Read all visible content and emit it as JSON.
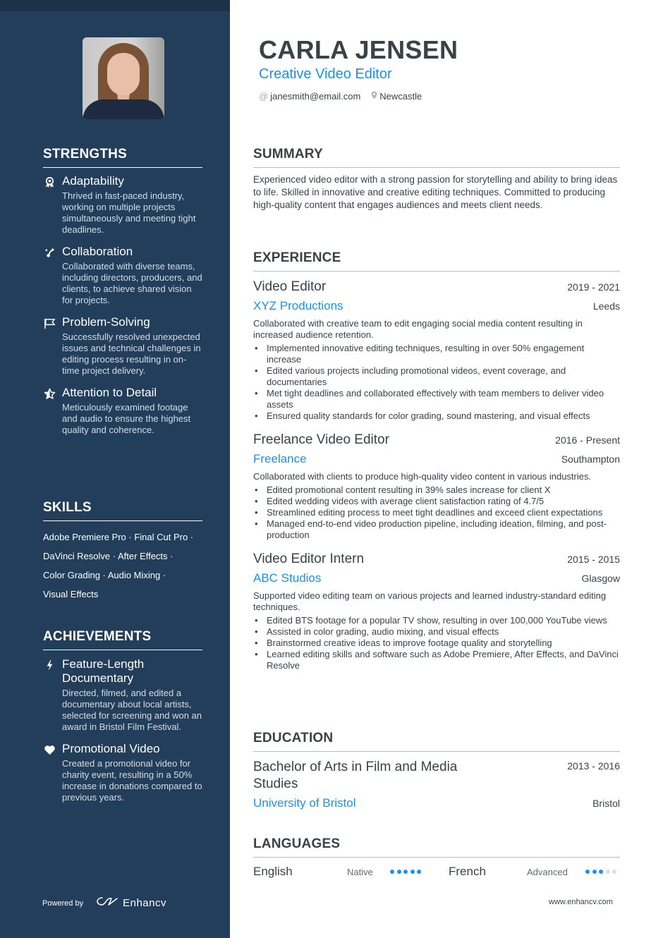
{
  "header": {
    "name": "CARLA JENSEN",
    "role": "Creative Video Editor",
    "email": "janesmith@email.com",
    "location": "Newcastle",
    "email_icon": "at-icon",
    "location_icon": "map-pin-icon"
  },
  "colors": {
    "sidebar": "#223e5a",
    "accent": "#1a91f0",
    "text": "#384347"
  },
  "strengths": {
    "title": "STRENGTHS",
    "items": [
      {
        "icon": "award-icon",
        "title": "Adaptability",
        "desc": "Thrived in fast-paced industry, working on multiple projects simultaneously and meeting tight deadlines."
      },
      {
        "icon": "route-icon",
        "title": "Collaboration",
        "desc": "Collaborated with diverse teams, including directors, producers, and clients, to achieve shared vision for projects."
      },
      {
        "icon": "flag-icon",
        "title": "Problem-Solving",
        "desc": "Successfully resolved unexpected issues and technical challenges in editing process resulting in on-time project delivery."
      },
      {
        "icon": "star-icon",
        "title": "Attention to Detail",
        "desc": "Meticulously examined footage and audio to ensure the highest quality and coherence."
      }
    ]
  },
  "skills": {
    "title": "SKILLS",
    "lines": [
      "Adobe Premiere Pro · Final Cut Pro ·",
      "DaVinci Resolve · After Effects ·",
      "Color Grading · Audio Mixing ·",
      "Visual Effects"
    ]
  },
  "achievements": {
    "title": "ACHIEVEMENTS",
    "items": [
      {
        "icon": "lightning-icon",
        "title": "Feature-Length Documentary",
        "desc": "Directed, filmed, and edited a documentary about local artists, selected for screening and won an award in Bristol Film Festival."
      },
      {
        "icon": "heart-icon",
        "title": "Promotional Video",
        "desc": "Created a promotional video for charity event, resulting in a 50% increase in donations compared to previous years."
      }
    ]
  },
  "footer": {
    "powered_by": "Powered by",
    "brand": "Enhancv",
    "website": "www.enhancv.com"
  },
  "summary": {
    "title": "SUMMARY",
    "text": "Experienced video editor with a strong passion for storytelling and ability to bring ideas to life. Skilled in innovative and creative editing techniques. Committed to producing high-quality content that engages audiences and meets client needs."
  },
  "experience": {
    "title": "EXPERIENCE",
    "jobs": [
      {
        "title": "Video Editor",
        "dates": "2019 - 2021",
        "company": "XYZ Productions",
        "location": "Leeds",
        "desc": "Collaborated with creative team to edit engaging social media content resulting in increased audience retention.",
        "bullets": [
          "Implemented innovative editing techniques, resulting in over 50% engagement increase",
          "Edited various projects including promotional videos, event coverage, and documentaries",
          "Met tight deadlines and collaborated effectively with team members to deliver video assets",
          "Ensured quality standards for color grading, sound mastering, and visual effects"
        ]
      },
      {
        "title": "Freelance Video Editor",
        "dates": "2016 - Present",
        "company": "Freelance",
        "location": "Southampton",
        "desc": "Collaborated with clients to produce high-quality video content in various industries.",
        "bullets": [
          "Edited promotional content resulting in 39% sales increase for client X",
          "Edited wedding videos with average client satisfaction rating of 4.7/5",
          "Streamlined editing process to meet tight deadlines and exceed client expectations",
          "Managed end-to-end video production pipeline, including ideation, filming, and post-production"
        ]
      },
      {
        "title": "Video Editor Intern",
        "dates": "2015 - 2015",
        "company": "ABC Studios",
        "location": "Glasgow",
        "desc": "Supported video editing team on various projects and learned industry-standard editing techniques.",
        "bullets": [
          "Edited BTS footage for a popular TV show, resulting in over 100,000 YouTube views",
          "Assisted in color grading, audio mixing, and visual effects",
          "Brainstormed creative ideas to improve footage quality and storytelling",
          "Learned editing skills and software such as Adobe Premiere, After Effects, and DaVinci Resolve"
        ]
      }
    ]
  },
  "education": {
    "title": "EDUCATION",
    "degree": "Bachelor of Arts in Film and Media Studies",
    "dates": "2013 - 2016",
    "school": "University of Bristol",
    "location": "Bristol"
  },
  "languages": {
    "title": "LANGUAGES",
    "items": [
      {
        "name": "English",
        "level": "Native",
        "rating": 5,
        "max": 5
      },
      {
        "name": "French",
        "level": "Advanced",
        "rating": 3,
        "max": 5
      }
    ]
  }
}
